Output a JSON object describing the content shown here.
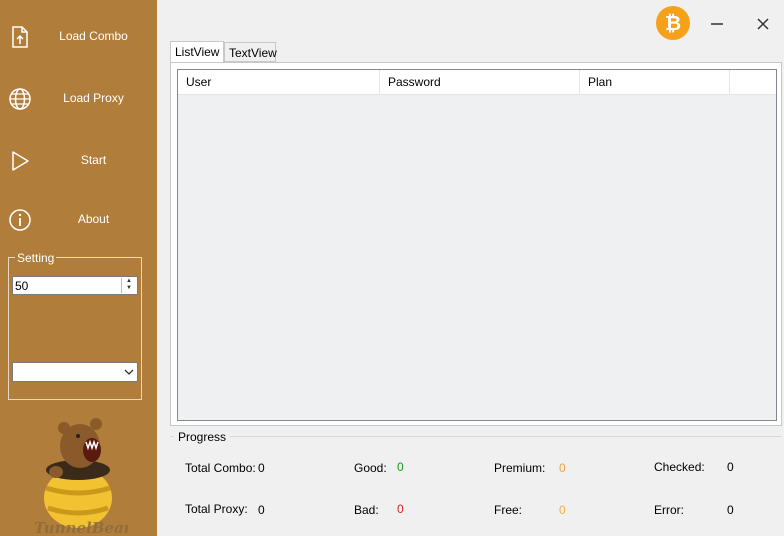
{
  "sidebar": {
    "items": [
      {
        "label": "Load Combo",
        "icon": "file-upload-icon"
      },
      {
        "label": "Load Proxy",
        "icon": "globe-icon"
      },
      {
        "label": "Start",
        "icon": "play-icon"
      },
      {
        "label": "About",
        "icon": "info-icon"
      }
    ],
    "setting": {
      "legend": "Setting",
      "threads_value": "50",
      "dropdown_value": ""
    },
    "logo_text": "TunnelBear"
  },
  "titlebar": {
    "bitcoin_color": "#f7a11a"
  },
  "tabs": [
    {
      "label": "ListView",
      "active": true
    },
    {
      "label": "TextView",
      "active": false
    }
  ],
  "listview": {
    "columns": [
      "User",
      "Password",
      "Plan",
      ""
    ],
    "rows": []
  },
  "progress": {
    "legend": "Progress",
    "total_combo": {
      "label": "Total Combo:",
      "value": "0"
    },
    "total_proxy": {
      "label": "Total Proxy:",
      "value": "0"
    },
    "good": {
      "label": "Good:",
      "value": "0",
      "color": "#1a9a1a"
    },
    "bad": {
      "label": "Bad:",
      "value": "0",
      "color": "#e02020"
    },
    "premium": {
      "label": "Premium:",
      "value": "0",
      "color": "#f0a040"
    },
    "free": {
      "label": "Free:",
      "value": "0",
      "color": "#f0b040"
    },
    "checked": {
      "label": "Checked:",
      "value": "0"
    },
    "error": {
      "label": "Error:",
      "value": "0"
    }
  }
}
